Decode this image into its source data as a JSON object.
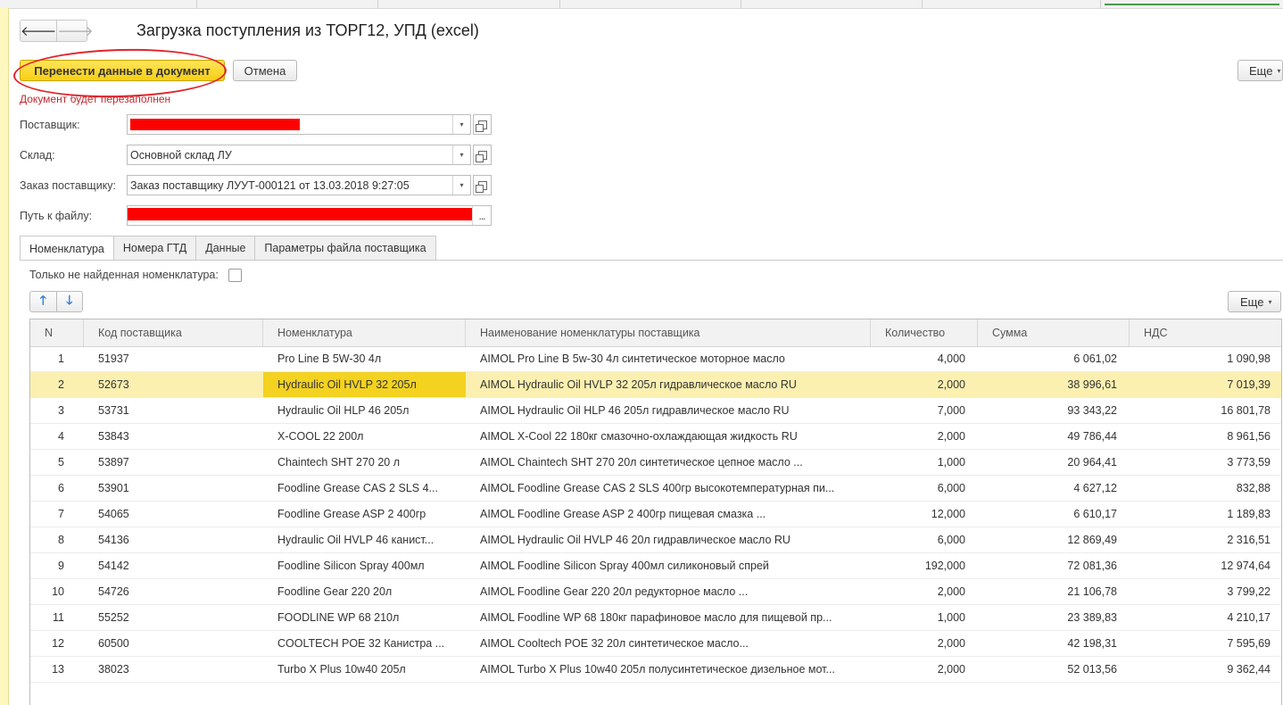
{
  "window": {
    "title": "Загрузка поступления из ТОРГ12, УПД (excel)"
  },
  "navigation": {
    "back_icon": "arrow-left-icon",
    "forward_icon": "arrow-right-icon",
    "back_glyph": "🡐",
    "forward_glyph": "🡒"
  },
  "toolbar": {
    "transfer_label": "Перенести данные в документ",
    "cancel_label": "Отмена",
    "more_label": "Еще",
    "caret": "▾"
  },
  "warning": "Документ будет перезаполнен",
  "form": {
    "supplier": {
      "label": "Поставщик:",
      "value": ""
    },
    "warehouse": {
      "label": "Склад:",
      "value": "Основной склад ЛУ"
    },
    "order": {
      "label": "Заказ поставщику:",
      "value": "Заказ поставщику ЛУУТ-000121 от 13.03.2018 9:27:05"
    },
    "file_path": {
      "label": "Путь к файлу:",
      "value": "",
      "browse": "..."
    },
    "dropdown_glyph": "▾"
  },
  "tabs": [
    {
      "label": "Номенклатура",
      "active": true
    },
    {
      "label": "Номера ГТД",
      "active": false
    },
    {
      "label": "Данные",
      "active": false
    },
    {
      "label": "Параметры файла поставщика",
      "active": false
    }
  ],
  "filter": {
    "label": "Только не найденная номенклатура:",
    "checked": false
  },
  "table_toolbar": {
    "move_up_glyph": "🡑",
    "move_down_glyph": "🡓",
    "more_label": "Еще"
  },
  "table": {
    "columns": [
      "N",
      "Код поставщика",
      "Номенклатура",
      "Наименование номенклатуры поставщика",
      "Количество",
      "Сумма",
      "НДС"
    ],
    "selected_row": 1,
    "rows": [
      [
        "1",
        "51937",
        "Pro Line B 5W-30    4л",
        "AIMOL Pro Line B 5w-30       4л синтетическое моторное масло",
        "4,000",
        "6 061,02",
        "1 090,98"
      ],
      [
        "2",
        "52673",
        "Hydraulic Oil HVLP 32   205л",
        "AIMOL Hydraulic Oil HVLP 32  205л  гидравлическое масло  RU",
        "2,000",
        "38 996,61",
        "7 019,39"
      ],
      [
        "3",
        "53731",
        "Hydraulic Oil HLP 46    205л",
        "AIMOL Hydraulic Oil HLP 46   205л гидравлическое масло  RU",
        "7,000",
        "93 343,22",
        "16 801,78"
      ],
      [
        "4",
        "53843",
        "X-COOL 22     200л",
        "AIMOL X-Cool 22    180кг смазочно-охлаждающая жидкость    RU",
        "2,000",
        "49 786,44",
        "8 961,56"
      ],
      [
        "5",
        "53897",
        "Chaintech SHT 270 20 л",
        "AIMOL Chaintech SHT 270    20л синтетическое цепное масло ...",
        "1,000",
        "20 964,41",
        "3 773,59"
      ],
      [
        "6",
        "53901",
        "Foodline Grease CAS 2 SLS 4...",
        "AIMOL Foodline Grease CAS 2 SLS    400гр высокотемпературная пи...",
        "6,000",
        "4 627,12",
        "832,88"
      ],
      [
        "7",
        "54065",
        "Foodline Grease ASP 2     400гр",
        "AIMOL Foodline Grease ASP 2      400гр пищевая смазка ...",
        "12,000",
        "6 610,17",
        "1 189,83"
      ],
      [
        "8",
        "54136",
        "Hydraulic Oil HVLP 46    канист...",
        "AIMOL Hydraulic Oil HVLP 46    20л  гидравлическое масло RU",
        "6,000",
        "12 869,49",
        "2 316,51"
      ],
      [
        "9",
        "54142",
        "Foodline Silicon Spray    400мл",
        "AIMOL Foodline Silicon Spray     400мл  силиконовый спрей",
        "192,000",
        "72 081,36",
        "12 974,64"
      ],
      [
        "10",
        "54726",
        "Foodline Gear 220    20л",
        "AIMOL Foodline Gear 220    20л редукторное масло ...",
        "2,000",
        "21 106,78",
        "3 799,22"
      ],
      [
        "11",
        "55252",
        "FOODLINE WP 68 210л",
        "AIMOL Foodline WP 68    180кг парафиновое масло для пищевой пр...",
        "1,000",
        "23 389,83",
        "4 210,17"
      ],
      [
        "12",
        "60500",
        "COOLTECH POE 32 Канистра ...",
        "AIMOL Cooltech POE 32    20л синтетическое масло...",
        "2,000",
        "42 198,31",
        "7 595,69"
      ],
      [
        "13",
        "38023",
        "Turbo X Plus 10w40     205л",
        "AIMOL Turbo X Plus 10w40     205л полусинтетическое дизельное мот...",
        "2,000",
        "52 013,56",
        "9 362,44"
      ]
    ]
  },
  "colors": {
    "primary_button": "#f6cf13",
    "selected_row": "#fbf0b0",
    "active_cell": "#f4d220",
    "warning_text": "#c0282d",
    "annotation_circle": "#e3232a",
    "redaction": "#ff0000"
  }
}
